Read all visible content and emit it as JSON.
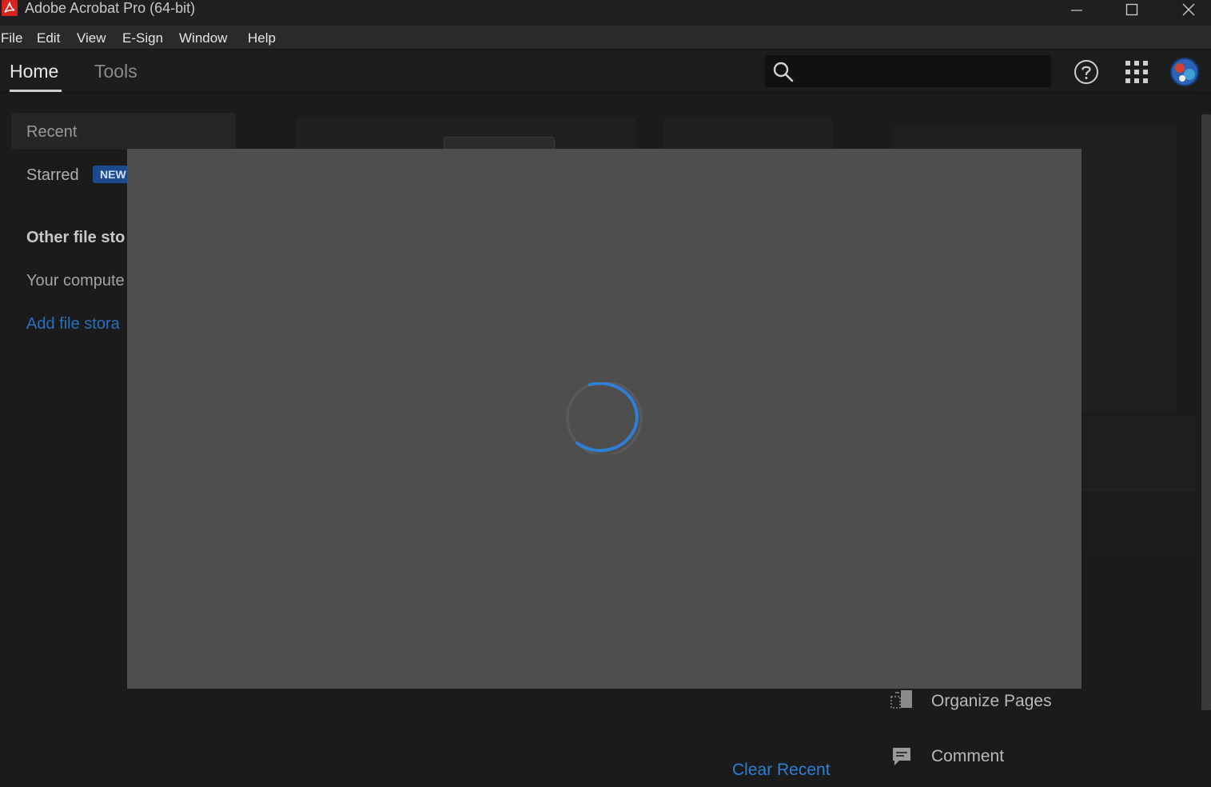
{
  "window": {
    "title": "Adobe Acrobat Pro (64-bit)"
  },
  "menubar": {
    "items": [
      "File",
      "Edit",
      "View",
      "E-Sign",
      "Window",
      "Help"
    ]
  },
  "topnav": {
    "tabs": [
      {
        "label": "Home",
        "active": true
      },
      {
        "label": "Tools",
        "active": false
      }
    ],
    "search": {
      "placeholder": "",
      "value": ""
    }
  },
  "sidebar": {
    "recent": "Recent",
    "starred": "Starred",
    "starred_badge": "NEW",
    "section_title": "Other file sto",
    "computer": "Your compute",
    "add_storage": "Add file stora"
  },
  "tools": {
    "organize_pages": "Organize Pages",
    "comment": "Comment"
  },
  "recent": {
    "clear": "Clear Recent"
  },
  "colors": {
    "accent": "#2f7fd6",
    "spinner": "#2f7fd6",
    "modal": "#4e4e4e",
    "app_red": "#d6231e"
  },
  "modal": {
    "state": "loading"
  }
}
